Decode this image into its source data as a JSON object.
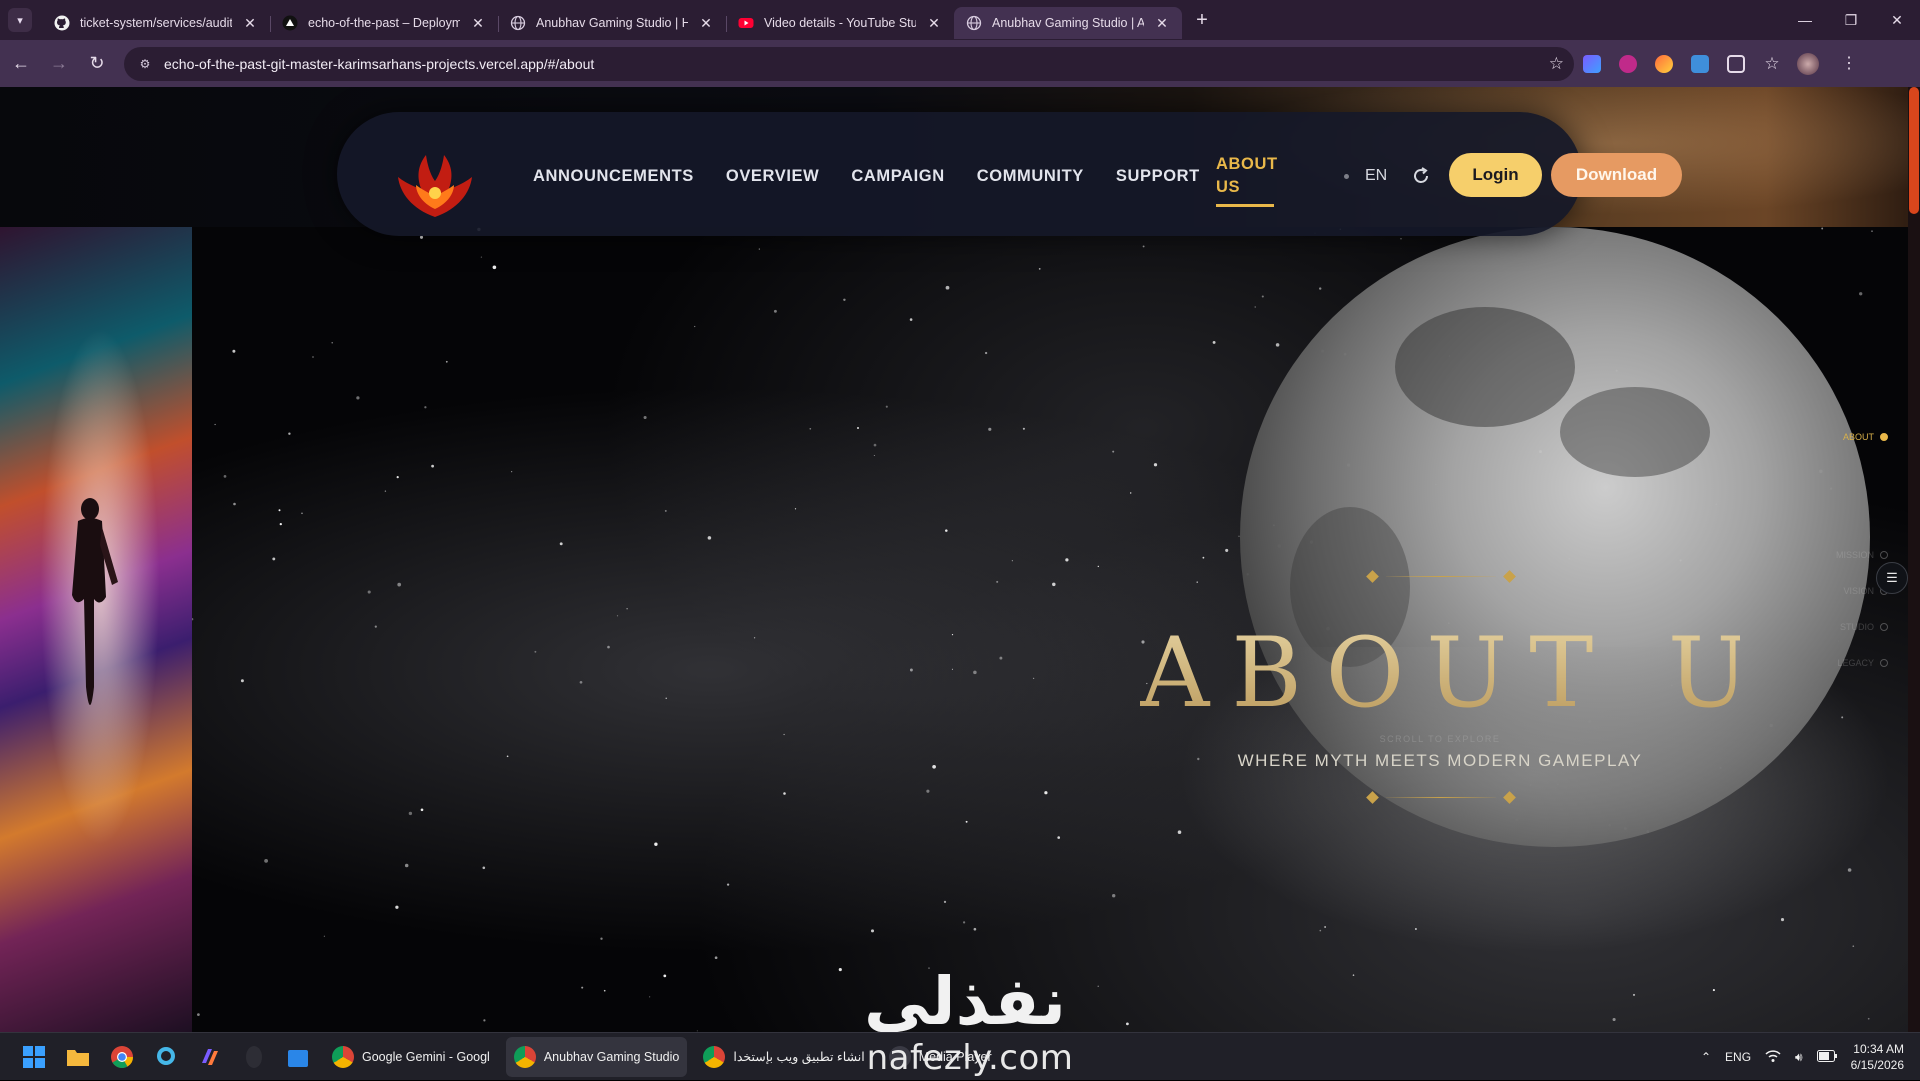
{
  "browser": {
    "tabs": [
      {
        "title": "ticket-system/services/auditSer",
        "icon": "github-icon"
      },
      {
        "title": "echo-of-the-past – Deploymen",
        "icon": "vercel-icon"
      },
      {
        "title": "Anubhav Gaming Studio | Hom",
        "icon": "globe-icon"
      },
      {
        "title": "Video details - YouTube Studio",
        "icon": "youtube-icon"
      },
      {
        "title": "Anubhav Gaming Studio | Abou",
        "icon": "globe-icon",
        "active": true
      }
    ],
    "url": "echo-of-the-past-git-master-karimsarhans-projects.vercel.app/#/about"
  },
  "site": {
    "nav": {
      "links": [
        "ANNOUNCEMENTS",
        "OVERVIEW",
        "CAMPAIGN",
        "COMMUNITY",
        "SUPPORT"
      ],
      "active_link_line1": "ABOUT",
      "active_link_line2": "US",
      "language": "EN",
      "login_label": "Login",
      "download_label": "Download"
    },
    "hero": {
      "title": "ABOUT US",
      "scroll_hint": "SCROLL TO EXPLORE",
      "subtitle": "WHERE MYTH MEETS MODERN GAMEPLAY"
    },
    "section_nav": {
      "items": [
        "ABOUT",
        "MISSION",
        "VISION",
        "STUDIO",
        "LEGACY"
      ],
      "active_index": 0
    }
  },
  "watermark": {
    "arabic": "نفذلي",
    "latin": "nafezly.com"
  },
  "taskbar": {
    "apps": [
      {
        "label": "Google Gemini - Googl"
      },
      {
        "label": "Anubhav Gaming Studio",
        "active": true
      },
      {
        "label": "انشاء تطبيق ويب بإستخدا"
      },
      {
        "label": "Media Player"
      }
    ],
    "language": "ENG",
    "time": "10:34 AM",
    "date": "6/15/2026"
  },
  "colors": {
    "accent_gold": "#e9b84a",
    "login_bg": "#f6cf6b",
    "download_bg": "#e69a62",
    "browser_chrome": "#433151"
  }
}
